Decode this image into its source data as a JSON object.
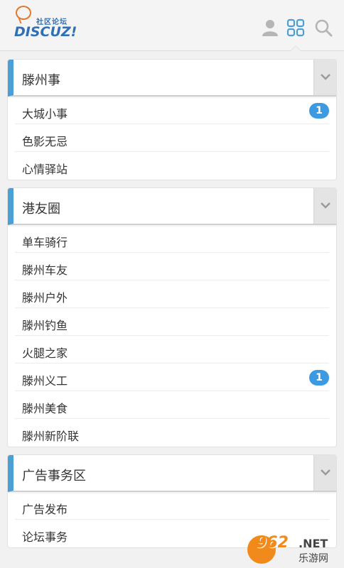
{
  "header": {
    "logo_tag": "社区论坛",
    "logo_brand": "DISCUZ!",
    "icons": [
      "user-icon",
      "grid-icon",
      "search-icon"
    ]
  },
  "colors": {
    "accent": "#4b9fd5",
    "badge": "#3b9ae1",
    "logo_blue": "#2f6fb5",
    "logo_orange": "#e0782e"
  },
  "groups": [
    {
      "title": "滕州事",
      "items": [
        {
          "label": "大城小事",
          "badge": "1"
        },
        {
          "label": "色影无忌",
          "badge": null
        },
        {
          "label": "心情驿站",
          "badge": null
        }
      ]
    },
    {
      "title": "港友圈",
      "items": [
        {
          "label": "单车骑行",
          "badge": null
        },
        {
          "label": "滕州车友",
          "badge": null
        },
        {
          "label": "滕州户外",
          "badge": null
        },
        {
          "label": "滕州钓鱼",
          "badge": null
        },
        {
          "label": "火腿之家",
          "badge": null
        },
        {
          "label": "滕州义工",
          "badge": "1"
        },
        {
          "label": "滕州美食",
          "badge": null
        },
        {
          "label": "滕州新阶联",
          "badge": null
        }
      ]
    },
    {
      "title": "广告事务区",
      "items": [
        {
          "label": "广告发布",
          "badge": null
        },
        {
          "label": "论坛事务",
          "badge": null
        }
      ]
    }
  ],
  "watermark": {
    "number": "962",
    "domain": ".NET",
    "cn": "乐游网"
  }
}
